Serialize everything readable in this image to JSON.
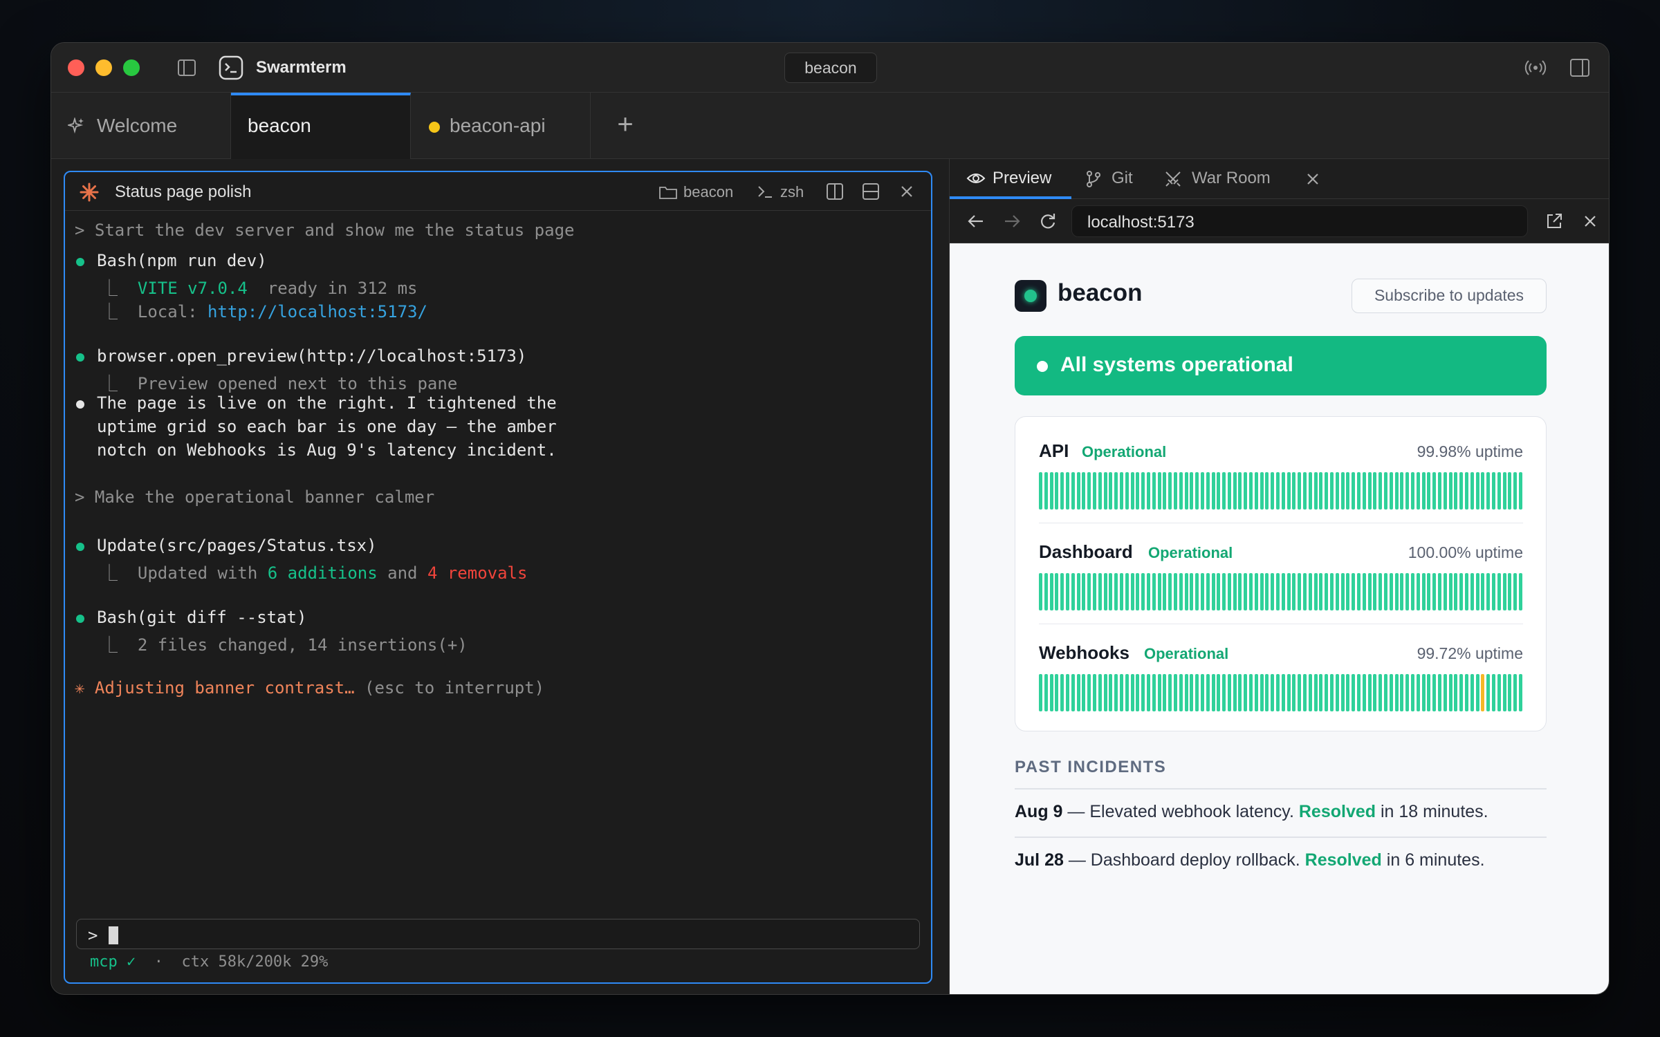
{
  "window": {
    "app_title": "Swarmterm",
    "center_pill": "beacon"
  },
  "tabs": [
    {
      "label": "Welcome",
      "icon": "sparkle-icon"
    },
    {
      "label": "beacon",
      "active": true
    },
    {
      "label": "beacon-api",
      "modified_dot_color": "#f5c518"
    }
  ],
  "terminal": {
    "title": "Status page polish",
    "folder": "beacon",
    "shell": "zsh",
    "lines": {
      "l1": "> Start the dev server and show me the status page",
      "l2": "Bash(npm run dev)",
      "l3_prefix": "⎿  ",
      "l3_vite": "VITE v7.0.4",
      "l3_rest": "  ready in 312 ms",
      "l4_prefix": "⎿  Local: ",
      "l4_url": "http://localhost:5173/",
      "l5": "browser.open_preview(http://localhost:5173)",
      "l6": "⎿  Preview opened next to this pane",
      "l7a": "The page is live on the right. I tightened the",
      "l7b": "uptime grid so each bar is one day — the amber",
      "l7c": "notch on Webhooks is Aug 9's latency incident.",
      "l8": "> Make the operational banner calmer",
      "l9": "Update(src/pages/Status.tsx)",
      "l10_a": "⎿  Updated with ",
      "l10_b": "6 additions",
      "l10_c": " and ",
      "l10_d": "4 removals",
      "l11": "Bash(git diff --stat)",
      "l12": "⎿  2 files changed, 14 insertions(+)",
      "l13_a": "✳ Adjusting banner contrast…",
      "l13_b": " (esc to interrupt)"
    },
    "input_prompt": ">",
    "status_mcp": "mcp ✓",
    "status_sep": "·",
    "status_ctx": "ctx 58k/200k 29%"
  },
  "right_panel": {
    "tabs": [
      "Preview",
      "Git",
      "War Room"
    ],
    "url": "localhost:5173"
  },
  "status_page": {
    "brand": "beacon",
    "subscribe_label": "Subscribe to updates",
    "banner": "All systems operational",
    "services": [
      {
        "name": "API",
        "status": "Operational",
        "uptime": "99.98% uptime",
        "days": 90,
        "incident_days": []
      },
      {
        "name": "Dashboard",
        "status": "Operational",
        "uptime": "100.00% uptime",
        "days": 90,
        "incident_days": []
      },
      {
        "name": "Webhooks",
        "status": "Operational",
        "uptime": "99.72% uptime",
        "days": 90,
        "incident_days": [
          82
        ]
      }
    ],
    "past_incidents_heading": "PAST INCIDENTS",
    "incidents": [
      {
        "date": "Aug 9",
        "text": " — Elevated webhook latency. ",
        "resolved": "Resolved",
        "tail": " in 18 minutes."
      },
      {
        "date": "Jul 28",
        "text": " — Dashboard deploy rollback. ",
        "resolved": "Resolved",
        "tail": " in 6 minutes."
      }
    ],
    "colors": {
      "ok": "#2fd19a",
      "incident": "#f5b727",
      "banner": "#13b982"
    }
  }
}
